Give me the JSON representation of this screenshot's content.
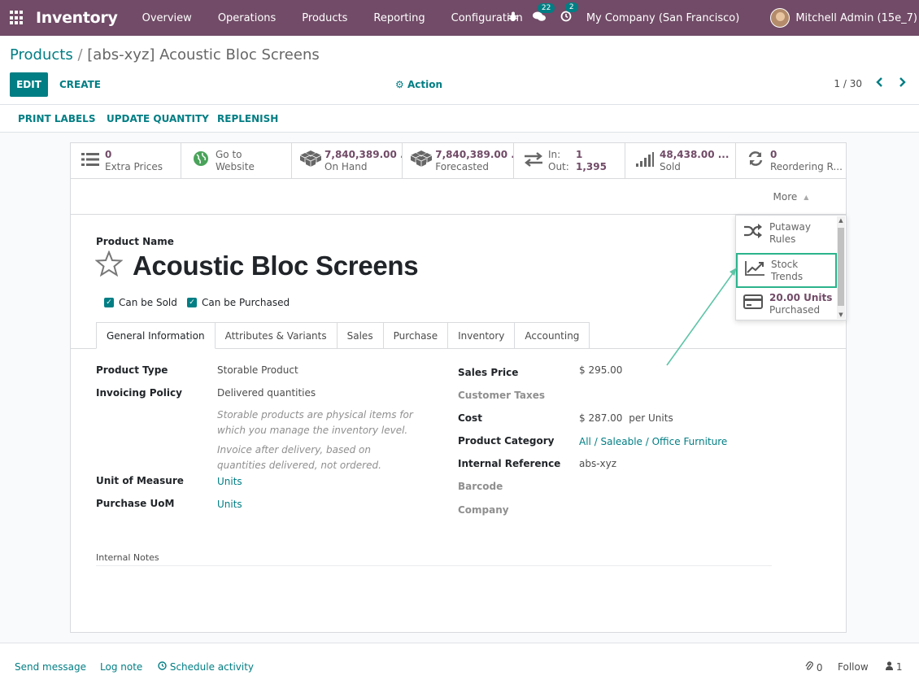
{
  "navbar": {
    "app_name": "Inventory",
    "menu": [
      "Overview",
      "Operations",
      "Products",
      "Reporting",
      "Configuration"
    ],
    "messages_count": "22",
    "activities_count": "2",
    "company": "My Company (San Francisco)",
    "user": "Mitchell Admin (15e_7)",
    "bg_color": "#714b67"
  },
  "breadcrumb": {
    "parent": "Products",
    "separator": "/",
    "current": "[abs-xyz] Acoustic Bloc Screens"
  },
  "toolbar": {
    "edit_label": "EDIT",
    "create_label": "CREATE",
    "action_label": "Action",
    "pager": "1 / 30"
  },
  "statusbar": {
    "print_labels": "PRINT LABELS",
    "update_quantity": "UPDATE QUANTITY",
    "replenish": "REPLENISH"
  },
  "smart_buttons": [
    {
      "icon": "list-icon",
      "value": "0",
      "label": "Extra Prices"
    },
    {
      "icon": "globe-icon",
      "value": "Go to",
      "label": "Website"
    },
    {
      "icon": "cubes-icon",
      "value": "7,840,389.00 ..",
      "label": "On Hand"
    },
    {
      "icon": "cubes-icon",
      "value": "7,840,389.00 ..",
      "label": "Forecasted"
    },
    {
      "icon": "exchange-icon",
      "in_label": "In:",
      "in_value": "1",
      "out_label": "Out:",
      "out_value": "1,395"
    },
    {
      "icon": "signal-icon",
      "value": "48,438.00 ...",
      "label": "Sold"
    },
    {
      "icon": "refresh-icon",
      "value": "0",
      "label": "Reordering R..."
    }
  ],
  "more_label": "More",
  "more_dropdown": [
    {
      "icon": "shuffle-icon",
      "value": "",
      "label1": "Putaway",
      "label2": "Rules"
    },
    {
      "icon": "line-chart-icon",
      "value": "",
      "label1": "Stock",
      "label2": "Trends"
    },
    {
      "icon": "credit-card-icon",
      "value": "20.00 Units",
      "label1": "",
      "label2": "Purchased"
    }
  ],
  "product": {
    "name_label": "Product Name",
    "name": "Acoustic Bloc Screens",
    "can_be_sold": "Can be Sold",
    "can_be_purchased": "Can be Purchased"
  },
  "tabs": [
    "General Information",
    "Attributes & Variants",
    "Sales",
    "Purchase",
    "Inventory",
    "Accounting"
  ],
  "general": {
    "product_type_label": "Product Type",
    "product_type": "Storable Product",
    "invoicing_policy_label": "Invoicing Policy",
    "invoicing_policy": "Delivered quantities",
    "help_storable": "Storable products are physical items for which you manage the inventory level.",
    "help_invoice": "Invoice after delivery, based on quantities delivered, not ordered.",
    "uom_label": "Unit of Measure",
    "uom": "Units",
    "purchase_uom_label": "Purchase UoM",
    "purchase_uom": "Units",
    "sales_price_label": "Sales Price",
    "sales_price": "$ 295.00",
    "customer_taxes_label": "Customer Taxes",
    "cost_label": "Cost",
    "cost": "$ 287.00",
    "cost_unit": "per Units",
    "category_label": "Product Category",
    "category": "All / Saleable / Office Furniture",
    "internal_ref_label": "Internal Reference",
    "internal_ref": "abs-xyz",
    "barcode_label": "Barcode",
    "company_label": "Company",
    "internal_notes_label": "Internal Notes"
  },
  "chatter": {
    "send_message": "Send message",
    "log_note": "Log note",
    "schedule_activity": "Schedule activity",
    "attachments": "0",
    "follow": "Follow",
    "followers": "1"
  },
  "accent_color": "#017e84",
  "highlight_color": "#2bb38c"
}
